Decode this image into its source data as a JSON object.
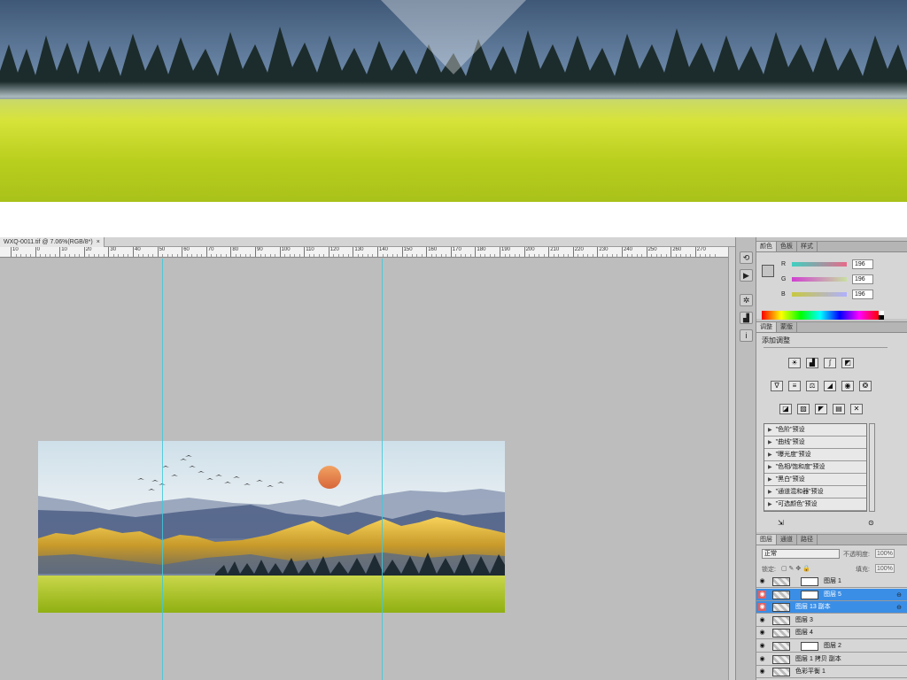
{
  "document": {
    "tab_title": "WXQ-0011.tif @ 7.06%(RGB/8*)",
    "close_glyph": "×",
    "ruler_labels": [
      "10",
      "0",
      "10",
      "20",
      "30",
      "40",
      "50",
      "60",
      "70",
      "80",
      "90",
      "100",
      "110",
      "120",
      "130",
      "140",
      "150",
      "160",
      "170",
      "180",
      "190",
      "200",
      "210",
      "220",
      "230",
      "240",
      "250",
      "260",
      "270"
    ]
  },
  "dock_icons": [
    "history-icon",
    "actions-icon",
    "settings-icon",
    "histogram-icon",
    "info-icon"
  ],
  "color_panel": {
    "tabs": [
      "颜色",
      "色板",
      "样式"
    ],
    "channels": [
      {
        "label": "R",
        "value": "196"
      },
      {
        "label": "G",
        "value": "196"
      },
      {
        "label": "B",
        "value": "196"
      }
    ],
    "foreground_color": "#c4c4c4"
  },
  "adjustments_panel": {
    "tabs": [
      "调整",
      "蒙版"
    ],
    "title": "添加调整",
    "presets": [
      "\"色阶\"预设",
      "\"曲线\"预设",
      "\"曝光度\"预设",
      "\"色相/饱和度\"预设",
      "\"黑白\"预设",
      "\"通道混和器\"预设",
      "\"可选颜色\"预设"
    ]
  },
  "layers_panel": {
    "tabs": [
      "图层",
      "通道",
      "路径"
    ],
    "blend_mode": "正常",
    "opacity_label": "不透明度:",
    "opacity_value": "100%",
    "lock_label": "锁定:",
    "fill_label": "填充:",
    "fill_value": "100%",
    "layers": [
      {
        "name": "图层 1",
        "selected": false,
        "mask": true,
        "link": false
      },
      {
        "name": "图层 5",
        "selected": true,
        "mask": true,
        "link": true
      },
      {
        "name": "图层 13 副本",
        "selected": true,
        "mask": false,
        "link": true
      },
      {
        "name": "图层 3",
        "selected": false,
        "mask": false,
        "link": false
      },
      {
        "name": "图层 4",
        "selected": false,
        "mask": false,
        "link": false
      },
      {
        "name": "图层 2",
        "selected": false,
        "mask": true,
        "link": false
      },
      {
        "name": "图层 1 拷贝 副本",
        "selected": false,
        "mask": false,
        "link": false
      },
      {
        "name": "色彩平衡 1",
        "selected": false,
        "mask": false,
        "link": false
      }
    ]
  },
  "colors": {
    "canvas_bg": "#bdbdbd",
    "guide": "#3fc9d9",
    "selection": "#3a8ee6"
  }
}
